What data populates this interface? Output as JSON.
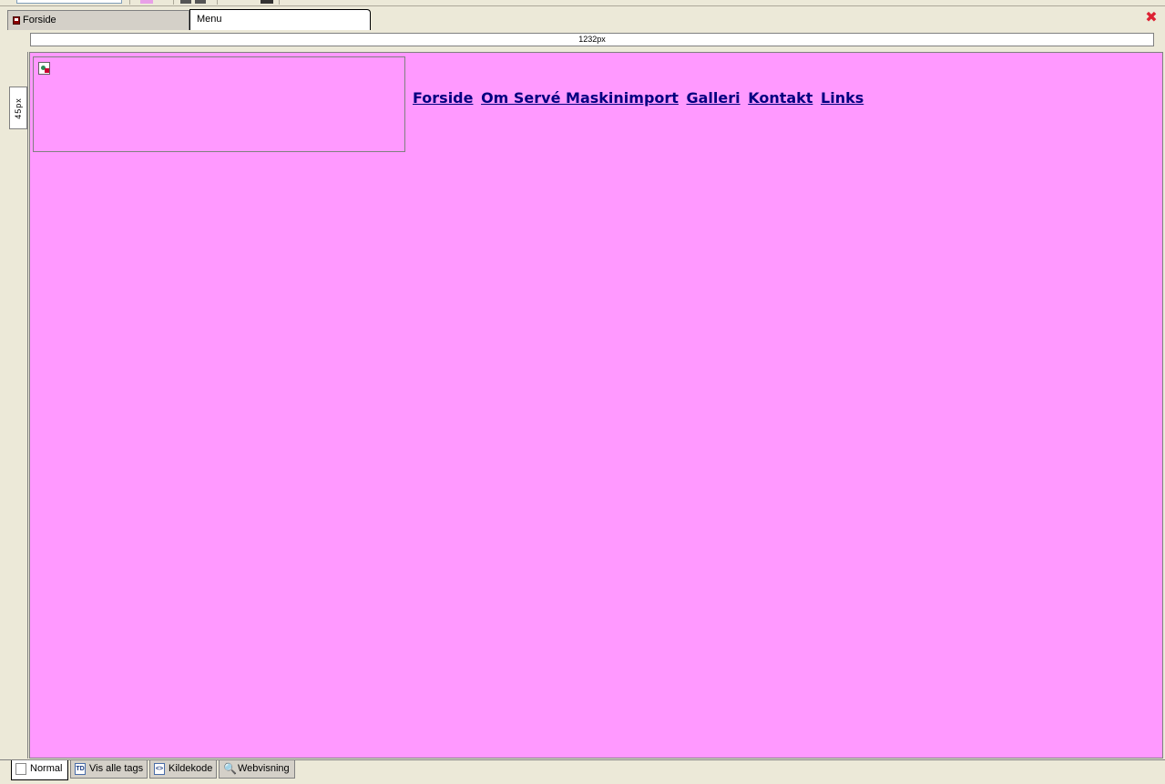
{
  "doc_tabs": [
    {
      "label": "Forside",
      "active": false
    },
    {
      "label": "Menu",
      "active": true
    }
  ],
  "ruler": {
    "width_label": "1232px",
    "height_label": "45px"
  },
  "canvas": {
    "background": "#ff99ff",
    "nav_links": [
      "Forside",
      "Om Servé Maskinimport",
      "Galleri",
      "Kontakt",
      "Links"
    ]
  },
  "view_tabs": [
    {
      "label": "Normal",
      "icon": "page-icon",
      "active": true
    },
    {
      "label": "Vis alle tags",
      "icon": "tag-icon",
      "icon_text": "TD",
      "active": false
    },
    {
      "label": "Kildekode",
      "icon": "source-code-icon",
      "icon_text": "<>",
      "active": false
    },
    {
      "label": "Webvisning",
      "icon": "magnifier-icon",
      "active": false
    }
  ],
  "colors": {
    "nav_link": "#000080",
    "close": "#dd2233"
  }
}
